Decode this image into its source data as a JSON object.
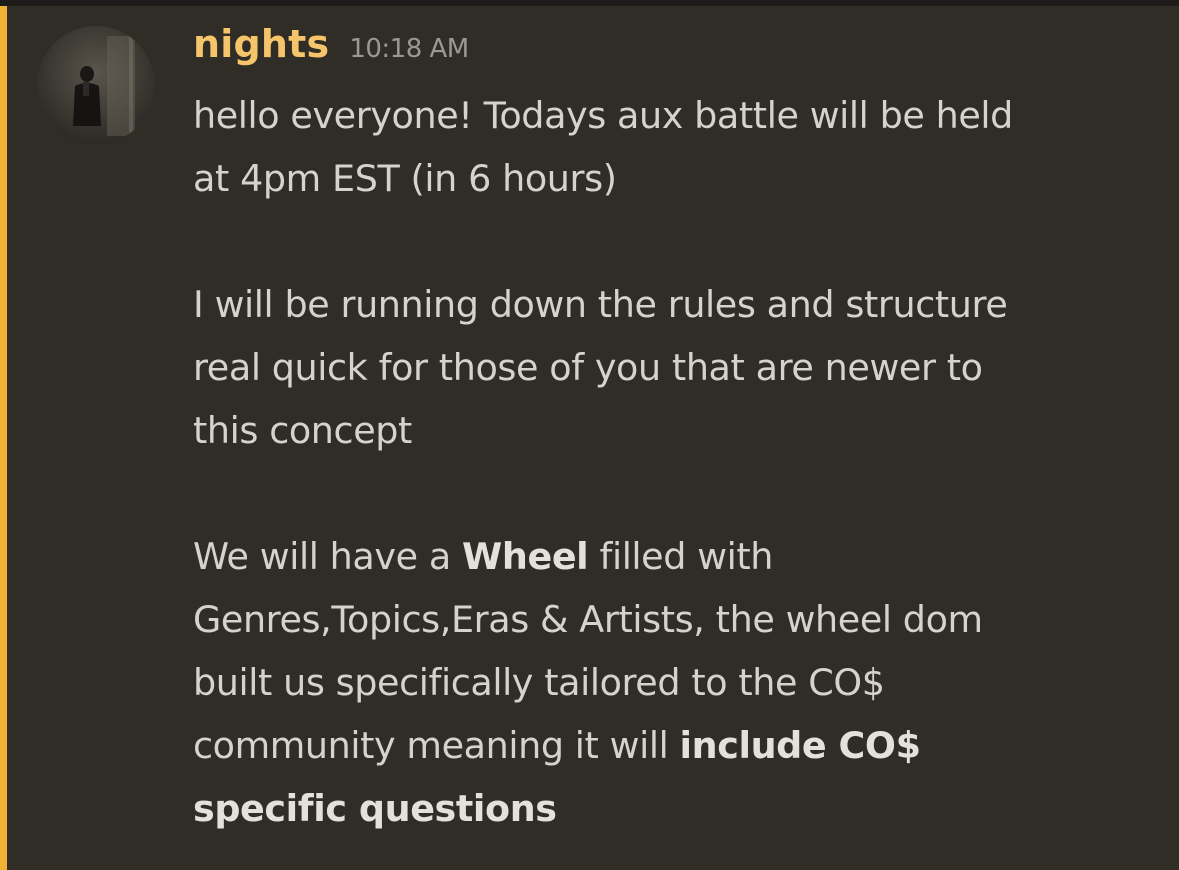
{
  "message": {
    "author": "nights",
    "timestamp": "10:18 AM",
    "author_color": "#f5c46b",
    "highlight_color": "#f0b232",
    "avatar_icon": "user-avatar",
    "paragraph1": {
      "line1": "hello everyone! Todays aux battle will be held",
      "line2": "at 4pm EST (in 6 hours)"
    },
    "paragraph2": {
      "line1": "I will be running down the rules and structure",
      "line2": "real quick for those of you that are newer to",
      "line3": "this concept"
    },
    "paragraph3": {
      "line1_pre": "We will have a ",
      "line1_bold": "Wheel",
      "line1_post": " filled with",
      "line2": "Genres,Topics,Eras & Artists, the wheel dom",
      "line3": "built us specifically tailored to the CO$",
      "line4_pre": "community meaning it will ",
      "line4_bold": "include CO$",
      "line5_bold": "specific questions"
    }
  }
}
